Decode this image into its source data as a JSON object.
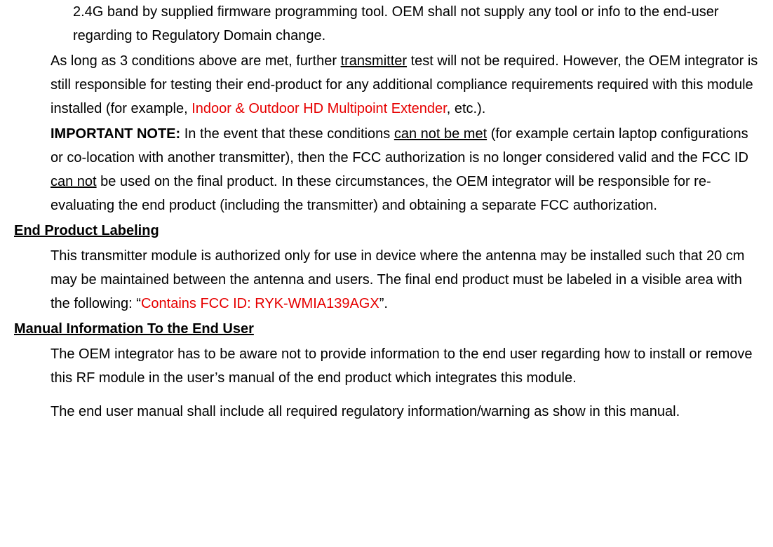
{
  "p1": {
    "text": "2.4G band by supplied firmware programming tool. OEM shall not supply any tool or info to the end-user regarding to Regulatory Domain change."
  },
  "p2": {
    "part1": "As long as 3 conditions above are met, further ",
    "u1": "transmitter",
    "part2": " test will not be required. However, the OEM integrator is still responsible for testing their end-product for any additional compliance requirements required with this module installed (for example, ",
    "red1": "Indoor & Outdoor HD Multipoint Extender",
    "part3": ", etc.)."
  },
  "p3": {
    "bold1": "IMPORTANT NOTE:",
    "part1": " In the event that these conditions ",
    "u1": "can not be met",
    "part2": " (for example certain laptop configurations or co-location with another transmitter), then the FCC authorization is no longer considered valid and the FCC ID ",
    "u2": "can not",
    "part3": " be used on the final product. In these circumstances, the OEM integrator will be responsible for re-evaluating the end product (including the transmitter) and obtaining a separate FCC authorization."
  },
  "h1": "End Product Labeling",
  "p4": {
    "part1": "This transmitter module is authorized only for use in device where the antenna may be installed such that 20 cm may be maintained between the antenna and users. The final end product must be labeled in a visible area with the following: “",
    "red1": "Contains FCC ID: RYK-WMIA139AGX",
    "part2": "”."
  },
  "h2": "Manual Information To the End User",
  "p5": {
    "text": "The OEM integrator has to be aware not to provide information to the end user regarding how to install or remove this RF module in the user’s manual of the end product which integrates this module."
  },
  "p6": {
    "text": "The end user manual shall include all required regulatory information/warning as show in this manual."
  }
}
